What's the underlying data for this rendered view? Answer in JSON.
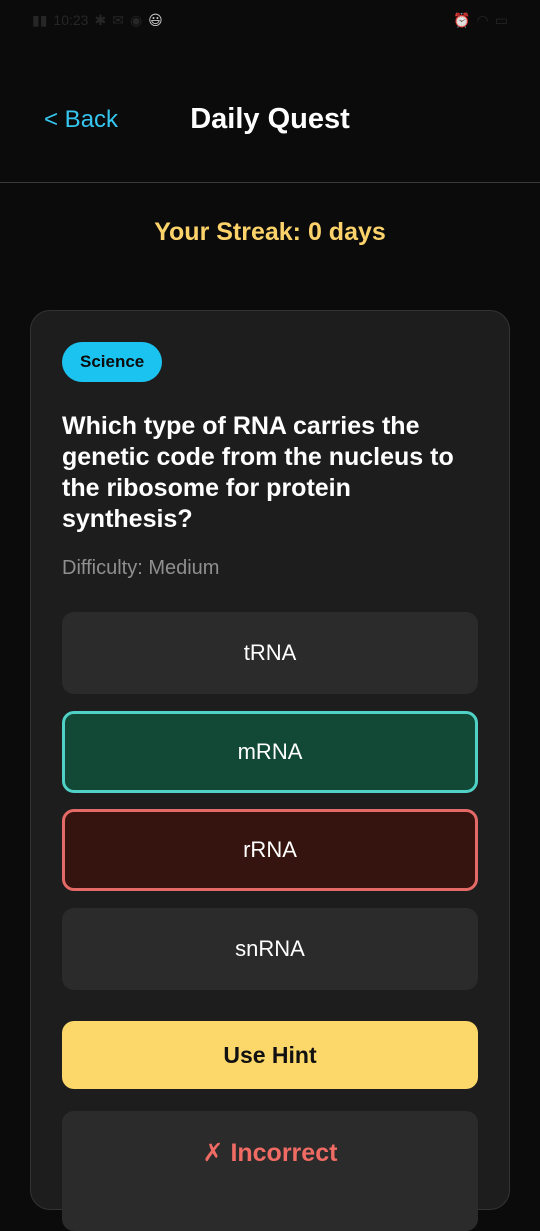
{
  "status_bar": {
    "time": "10:23",
    "emoji": "😃"
  },
  "header": {
    "back_label": "< Back",
    "title": "Daily Quest"
  },
  "streak": {
    "text": "Your Streak: 0 days"
  },
  "quest": {
    "category": "Science",
    "question": "Which type of RNA carries the genetic code from the nucleus to the ribosome for protein synthesis?",
    "difficulty": "Difficulty: Medium",
    "options": [
      {
        "label": "tRNA",
        "state": "default"
      },
      {
        "label": "mRNA",
        "state": "correct"
      },
      {
        "label": "rRNA",
        "state": "wrong"
      },
      {
        "label": "snRNA",
        "state": "default"
      }
    ],
    "hint_label": "Use Hint",
    "result_text": "✗ Incorrect"
  },
  "colors": {
    "accent_blue": "#35c6f0",
    "streak_yellow": "#fcd36b",
    "correct_border": "#4fd1c5",
    "wrong_border": "#e46a67",
    "hint_yellow": "#fcd86a",
    "incorrect_red": "#ef6b63"
  }
}
